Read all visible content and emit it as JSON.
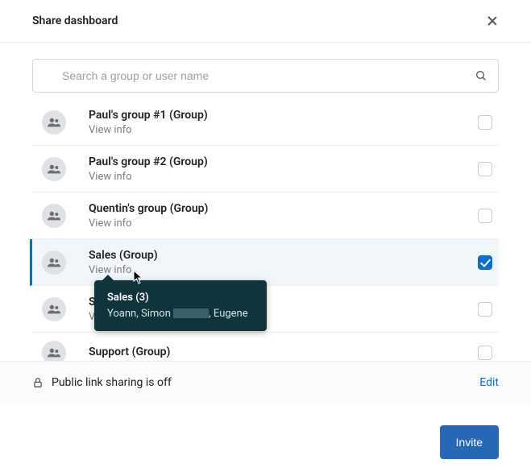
{
  "header": {
    "title": "Share dashboard"
  },
  "search": {
    "placeholder": "Search a group or user name"
  },
  "view_info": "View info",
  "rows": [
    {
      "title": "Paul's group #1 (Group)",
      "checked": false,
      "partial": false
    },
    {
      "title": "Paul's group #2 (Group)",
      "checked": false,
      "partial": false
    },
    {
      "title": "Quentin's group (Group)",
      "checked": false,
      "partial": false
    },
    {
      "title": "Sales (Group)",
      "checked": true,
      "partial": false
    },
    {
      "title": "S",
      "checked": false,
      "partial": true
    },
    {
      "title": "Support (Group)",
      "checked": false,
      "partial": true,
      "cutoff": true
    }
  ],
  "tooltip": {
    "title": "Sales (3)",
    "prefix": "Yoann, Simon ",
    "suffix": ", Eugene"
  },
  "footer": {
    "status": "Public link sharing is off",
    "edit": "Edit",
    "invite": "Invite"
  }
}
